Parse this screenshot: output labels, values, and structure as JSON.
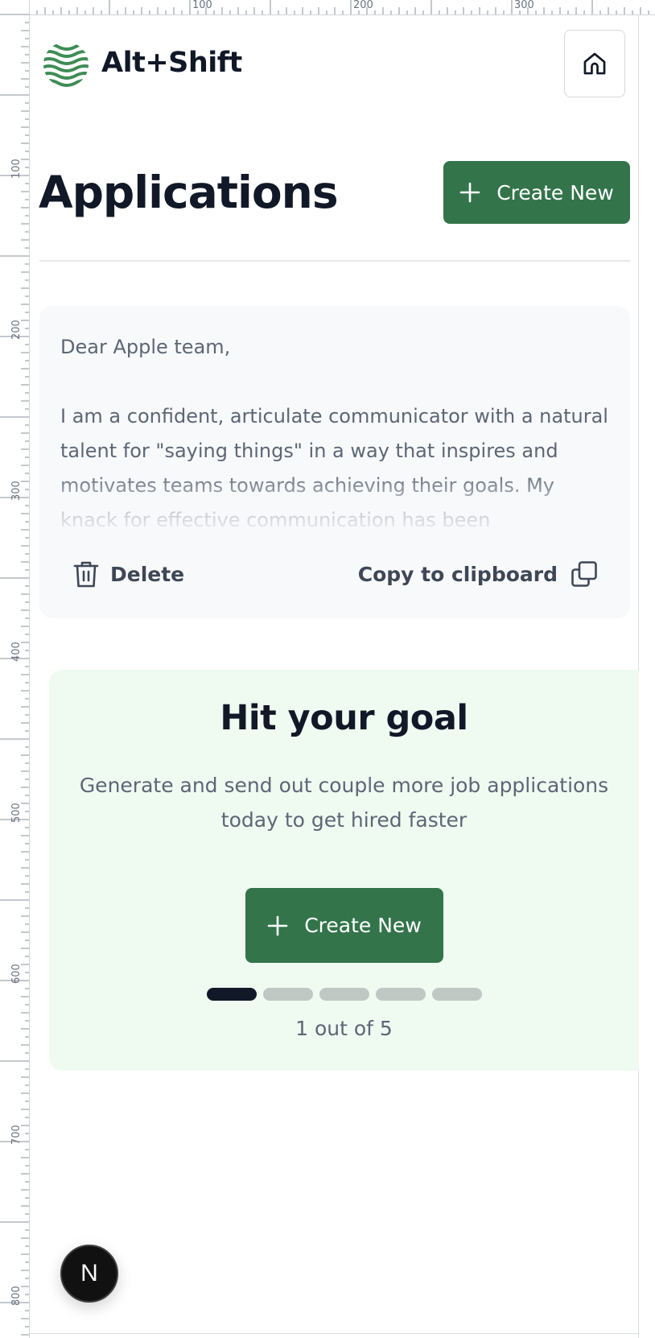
{
  "ruler": {
    "top_labels": [
      "100",
      "200",
      "300"
    ],
    "left_labels": [
      "100",
      "200",
      "300",
      "400",
      "500",
      "600",
      "700",
      "800"
    ]
  },
  "header": {
    "brand": "Alt+Shift",
    "logo_icon": "wave-globe-logo-icon",
    "home_icon": "home-icon"
  },
  "title_row": {
    "title": "Applications",
    "create_label": "Create New"
  },
  "letter": {
    "text": "Dear Apple team,\n\nI am a confident, articulate communicator with a natural talent for \"saying things\" in a way that inspires and motivates teams towards achieving their goals. My knack for effective communication has been",
    "delete_label": "Delete",
    "copy_label": "Copy to clipboard"
  },
  "goal": {
    "title": "Hit your goal",
    "text": "Generate and send out couple more job applications today to get hired faster",
    "create_label": "Create New",
    "progress_current": 1,
    "progress_total": 5,
    "progress_text": "1 out of 5"
  },
  "badge": {
    "label": "N"
  },
  "colors": {
    "brand_green": "#33744a",
    "goal_background": "#effaf1",
    "card_background": "#f8f9fb",
    "text_dark": "#111827",
    "text_muted": "#5d6675"
  }
}
